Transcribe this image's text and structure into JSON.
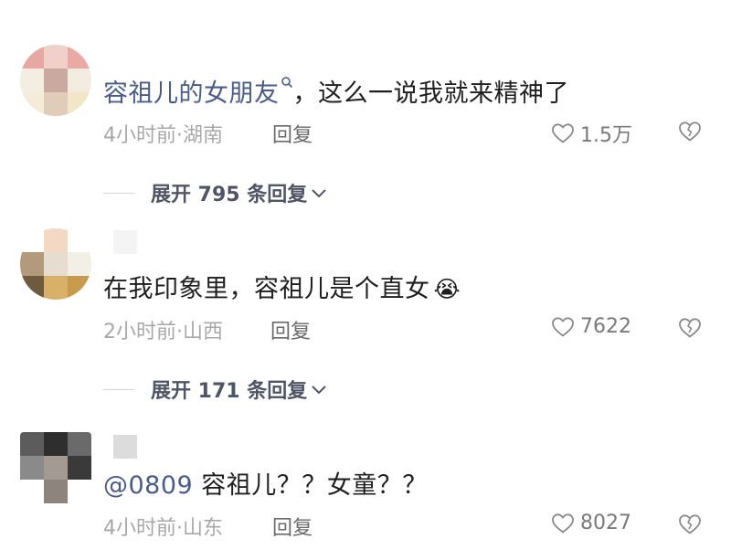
{
  "comments": [
    {
      "username": "容祖儿的女朋友",
      "text": "，这么一说我就来精神了",
      "time": "4小时前",
      "location": "湖南",
      "reply_label": "回复",
      "likes": "1.5万",
      "replies_label": "展开 795 条回复"
    },
    {
      "text": "在我印象里，容祖儿是个直女",
      "emoji": "😭",
      "time": "2小时前",
      "location": "山西",
      "reply_label": "回复",
      "likes": "7622",
      "replies_label": "展开 171 条回复"
    },
    {
      "mention": "@0809",
      "text": " 容祖儿？？女童？？",
      "time": "4小时前",
      "location": "山东",
      "reply_label": "回复",
      "likes": "8027"
    }
  ],
  "meta_separator": "·",
  "colors": {
    "link": "#4a5c8a",
    "meta": "#a8a8a8",
    "text": "#1f1f1f"
  },
  "icons": {
    "like": "heart-outline-icon",
    "dislike": "broken-heart-icon",
    "expand": "chevron-down-icon",
    "search": "search-icon"
  }
}
